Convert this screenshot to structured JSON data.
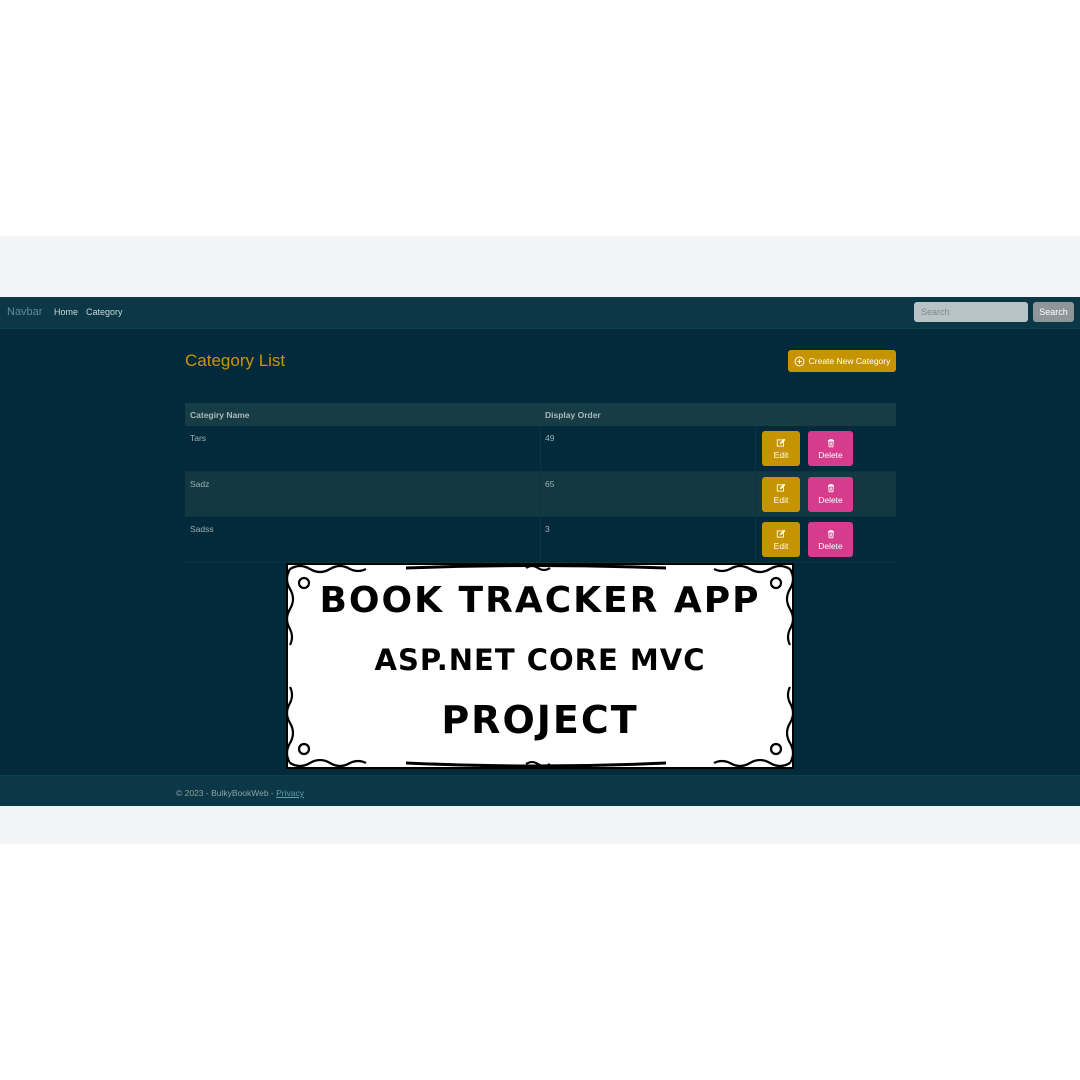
{
  "navbar": {
    "brand": "Navbar",
    "links": [
      "Home",
      "Category"
    ],
    "search_placeholder": "Search",
    "search_button": "Search"
  },
  "page": {
    "title": "Category List",
    "create_button": "Create New Category"
  },
  "table": {
    "headers": [
      "Categiry Name",
      "Display Order"
    ],
    "rows": [
      {
        "name": "Tars",
        "order": "49"
      },
      {
        "name": "Sadz",
        "order": "65"
      },
      {
        "name": "Sadss",
        "order": "3"
      }
    ],
    "edit_label": "Edit",
    "delete_label": "Delete"
  },
  "footer": {
    "text": "© 2023 - BulkyBookWeb - ",
    "link": "Privacy"
  },
  "banner": {
    "line1": "BOOK TRACKER APP",
    "line2": "ASP.NET CORE MVC",
    "line3": "PROJECT"
  },
  "colors": {
    "app_background": "#022a3a",
    "navbar": "#0b3746",
    "accent_gold": "#c59400",
    "delete_pink": "#d63c8c",
    "title_gold": "#c8960c"
  },
  "icons": {
    "create": "plus-circle-icon",
    "edit": "pencil-square-icon",
    "delete": "trash-icon"
  }
}
